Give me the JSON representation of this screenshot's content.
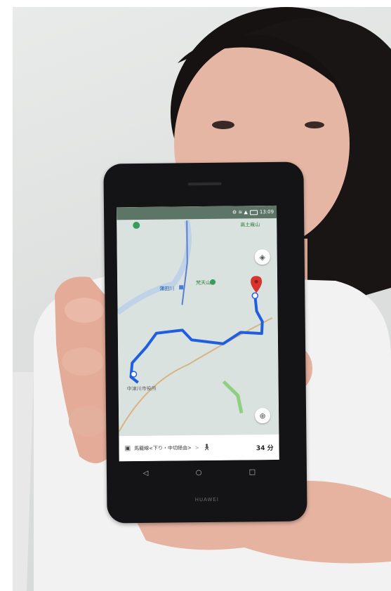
{
  "photo": {
    "subject": "woman holding smartphone",
    "colors": {
      "background": "#e2e4e3",
      "hair": "#161212",
      "skin": "#e7b8a7",
      "shirt": "#f3f3f3",
      "phone": "#141416",
      "route": "#1f5ee0"
    }
  },
  "phone": {
    "brand": "HUAWEI",
    "status_bar": {
      "icons": "⚙ ≋ ▲",
      "time": "13:09"
    },
    "map": {
      "labels": {
        "mountain_top": "高土幾山",
        "mountain_center": "梵天山",
        "town": "蒲田川",
        "city_office": "中津川市役所"
      },
      "destination_pin": "map-pin-icon",
      "layers_icon": "layers-icon",
      "compass_icon": "compass-icon"
    },
    "directions_bar": {
      "bus_icon": "bus-icon",
      "route_name": "馬籠線<下り・中切経由>",
      "separator": ">",
      "walk_icon": "walk-icon",
      "duration": "34 分"
    },
    "nav_buttons": {
      "back": "◁",
      "home": "○",
      "recent": "□"
    }
  }
}
